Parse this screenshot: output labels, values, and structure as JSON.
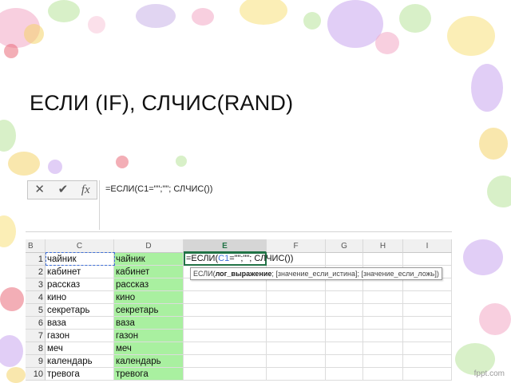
{
  "slide": {
    "title": "ЕСЛИ (IF), СЛЧИС(RAND)"
  },
  "formula_bar": {
    "cancel_icon": "close-icon",
    "enter_icon": "check-icon",
    "fx_label": "fx",
    "formula": "=ЕСЛИ(C1=\"\";\"\"; СЛЧИС())"
  },
  "columns": [
    "B",
    "C",
    "D",
    "E",
    "F",
    "G",
    "H",
    "I"
  ],
  "selected_column": "E",
  "rows": [
    {
      "num": "1",
      "c": "чайник",
      "d": "чайник"
    },
    {
      "num": "2",
      "c": "кабинет",
      "d": "кабинет"
    },
    {
      "num": "3",
      "c": "рассказ",
      "d": "рассказ"
    },
    {
      "num": "4",
      "c": "кино",
      "d": "кино"
    },
    {
      "num": "5",
      "c": "секретарь",
      "d": "секретарь"
    },
    {
      "num": "6",
      "c": "ваза",
      "d": "ваза"
    },
    {
      "num": "7",
      "c": "газон",
      "d": "газон"
    },
    {
      "num": "8",
      "c": "меч",
      "d": "меч"
    },
    {
      "num": "9",
      "c": "календарь",
      "d": "календарь"
    },
    {
      "num": "10",
      "c": "тревога",
      "d": "тревога"
    }
  ],
  "active_cell": {
    "prefix": "=ЕСЛИ(",
    "ref": "C1",
    "suffix": "=\"\";\"\"; СЛЧИС())"
  },
  "tooltip": {
    "fn": "ЕСЛИ(",
    "arg1": "лог_выражение",
    "rest": "; [значение_если_истина]; [значение_если_ложь])"
  },
  "watermark": "fppt.com",
  "colors": {
    "highlight": "#a9f0a0",
    "excel_green": "#217346",
    "ref_blue": "#3f6fd8"
  }
}
